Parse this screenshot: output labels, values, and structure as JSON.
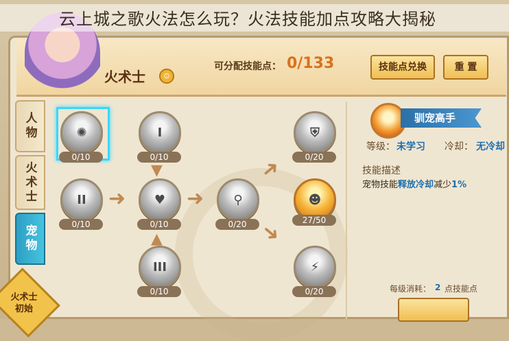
{
  "banner": {
    "title": "云上城之歌火法怎么玩？火法技能加点攻略大揭秘"
  },
  "header": {
    "class_name": "火术士",
    "class_icon_symbol": "⊙",
    "points_label": "可分配技能点：",
    "points_value": "0/133",
    "exchange_button": "技能点兑换",
    "reset_button": "重 置"
  },
  "tabs": [
    {
      "label": "人物",
      "active": false
    },
    {
      "label": "火术士",
      "active": false
    },
    {
      "label": "宠物",
      "active": true
    }
  ],
  "badge": {
    "line1": "火术士",
    "line2": "初始"
  },
  "skills": [
    {
      "id": "top-left",
      "symbol": "✺",
      "count": "0/10",
      "selected": true,
      "gold": false
    },
    {
      "id": "tier-1",
      "symbol": "I",
      "count": "0/10",
      "selected": false,
      "gold": false
    },
    {
      "id": "tier-2",
      "symbol": "II",
      "count": "0/10",
      "selected": false,
      "gold": false
    },
    {
      "id": "heart",
      "symbol": "♥",
      "count": "0/10",
      "selected": false,
      "gold": false
    },
    {
      "id": "tier-3",
      "symbol": "III",
      "count": "0/10",
      "selected": false,
      "gold": false
    },
    {
      "id": "pet-center",
      "symbol": "⚲",
      "count": "0/20",
      "selected": false,
      "gold": false
    },
    {
      "id": "shield",
      "symbol": "⛨",
      "count": "0/20",
      "selected": false,
      "gold": false
    },
    {
      "id": "gold-pet",
      "symbol": "☻",
      "count": "27/50",
      "selected": false,
      "gold": true
    },
    {
      "id": "bolt",
      "symbol": "⚡",
      "count": "0/20",
      "selected": false,
      "gold": false
    }
  ],
  "detail": {
    "skill_name": "驯宠高手",
    "level_label": "等级：",
    "level_value": "未学习",
    "cooldown_label": "冷却：",
    "cooldown_value": "无冷却",
    "desc_title": "技能描述",
    "desc_prefix": "宠物技能",
    "desc_highlight": "释放冷却",
    "desc_middle": "减少",
    "desc_value": "1%",
    "cost_label": "每级消耗：",
    "cost_value": "2",
    "cost_unit": "点技能点"
  }
}
